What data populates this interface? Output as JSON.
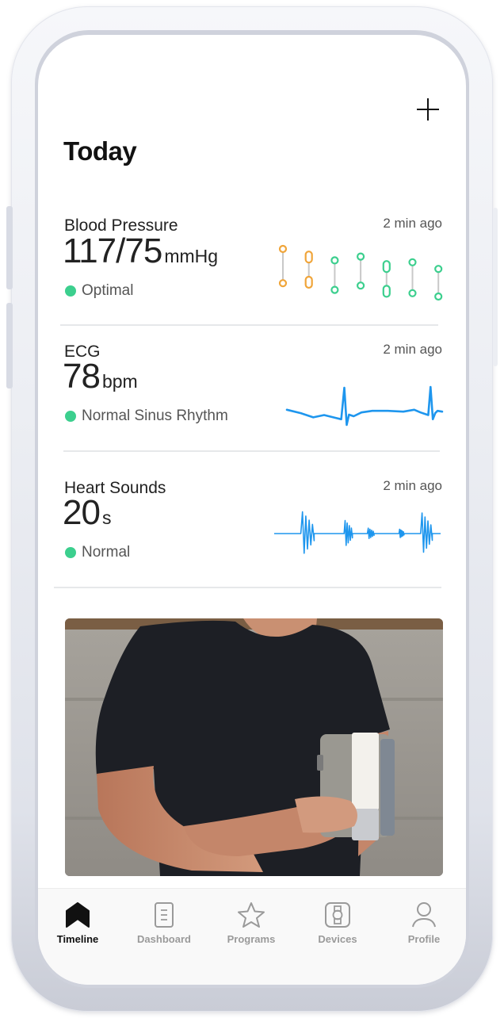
{
  "header": {
    "title": "Today",
    "add_button_icon": "plus-icon"
  },
  "cards": [
    {
      "id": "blood-pressure",
      "title": "Blood Pressure",
      "time": "2 min ago",
      "value": "117/75",
      "unit": "mmHg",
      "status": "Optimal",
      "status_color": "#3ccf8e"
    },
    {
      "id": "ecg",
      "title": "ECG",
      "time": "2 min ago",
      "value": "78",
      "unit": "bpm",
      "status": "Normal Sinus Rhythm",
      "status_color": "#3ccf8e"
    },
    {
      "id": "heart-sounds",
      "title": "Heart Sounds",
      "time": "2 min ago",
      "value": "20",
      "unit": "s",
      "status": "Normal",
      "status_color": "#3ccf8e"
    }
  ],
  "colors": {
    "bp_elevated": "#f0a53a",
    "bp_optimal": "#3ccf8e",
    "waveform": "#1e96ee",
    "bp_stem": "#c8c8c8"
  },
  "chart_data": [
    {
      "type": "range",
      "title": "Blood Pressure trend",
      "readings": [
        {
          "level": "elevated",
          "high": 0.0,
          "low": 0.72,
          "high_shape": "circle",
          "low_shape": "circle"
        },
        {
          "level": "elevated",
          "high": 0.17,
          "low": 0.7,
          "high_shape": "pill",
          "low_shape": "pill"
        },
        {
          "level": "optimal",
          "high": 0.24,
          "low": 0.86,
          "high_shape": "circle",
          "low_shape": "circle"
        },
        {
          "level": "optimal",
          "high": 0.16,
          "low": 0.77,
          "high_shape": "circle",
          "low_shape": "circle"
        },
        {
          "level": "optimal",
          "high": 0.37,
          "low": 0.89,
          "high_shape": "pill",
          "low_shape": "pill"
        },
        {
          "level": "optimal",
          "high": 0.28,
          "low": 0.93,
          "high_shape": "circle",
          "low_shape": "circle"
        },
        {
          "level": "optimal",
          "high": 0.42,
          "low": 1.0,
          "high_shape": "circle",
          "low_shape": "circle"
        }
      ]
    },
    {
      "type": "line",
      "title": "ECG waveform",
      "x": [
        0,
        0.09,
        0.17,
        0.24,
        0.32,
        0.35,
        0.37,
        0.385,
        0.4,
        0.43,
        0.48,
        0.55,
        0.65,
        0.75,
        0.82,
        0.86,
        0.91,
        0.925,
        0.94,
        0.955,
        0.97,
        1.0
      ],
      "y": [
        0.4,
        0.31,
        0.2,
        0.26,
        0.18,
        0.15,
        0.98,
        0.0,
        0.27,
        0.23,
        0.33,
        0.37,
        0.37,
        0.35,
        0.4,
        0.33,
        0.26,
        1.0,
        0.15,
        0.31,
        0.37,
        0.35
      ]
    },
    {
      "type": "line",
      "title": "Heart sounds waveform",
      "bursts": [
        {
          "start": 0.16,
          "end": 0.24,
          "amplitude": 1.0
        },
        {
          "start": 0.42,
          "end": 0.47,
          "amplitude": 0.6
        },
        {
          "start": 0.56,
          "end": 0.6,
          "amplitude": 0.25
        },
        {
          "start": 0.75,
          "end": 0.78,
          "amplitude": 0.2
        },
        {
          "start": 0.88,
          "end": 0.95,
          "amplitude": 0.95
        }
      ]
    }
  ],
  "promo": {
    "alt": "Man wearing blood pressure cuff on upper arm"
  },
  "tabs": [
    {
      "label": "Timeline",
      "icon": "bookmark-icon",
      "active": true
    },
    {
      "label": "Dashboard",
      "icon": "document-icon",
      "active": false
    },
    {
      "label": "Programs",
      "icon": "star-icon",
      "active": false
    },
    {
      "label": "Devices",
      "icon": "watch-icon",
      "active": false
    },
    {
      "label": "Profile",
      "icon": "person-icon",
      "active": false
    }
  ]
}
